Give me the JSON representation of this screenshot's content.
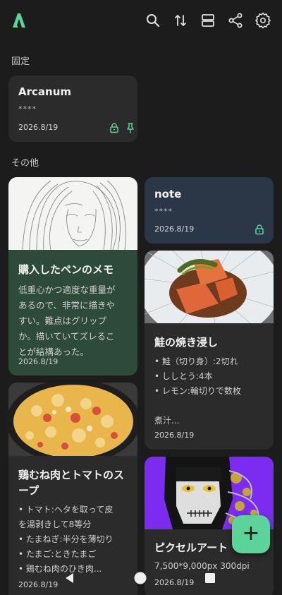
{
  "toolbar": {
    "logo_icon": "app-logo-icon",
    "icons": [
      "search-icon",
      "sort-icon",
      "layout-icon",
      "share-icon",
      "settings-icon"
    ],
    "accent_color": "#5bd39a"
  },
  "sections": {
    "pinned": "固定",
    "others": "その他"
  },
  "pinned_note": {
    "title": "Arcanum",
    "masked": "****",
    "date": "2026.8/19",
    "icons": [
      "lock-icon",
      "pin-icon"
    ]
  },
  "notes": {
    "pen_memo": {
      "title": "購入したペンのメモ",
      "body": [
        "低重心かつ適度な重量が",
        "あるので、非常に描きや",
        "すい。難点はグリップ",
        "か。描いていてズレるこ",
        "とが結構あった。"
      ],
      "date": "2026.8/19",
      "background": "#2e4a3a"
    },
    "locked_note": {
      "title": "note",
      "masked": "****",
      "date": "2026.8/19",
      "background": "#2b3746"
    },
    "salmon": {
      "title": "鮭の焼き浸し",
      "lines": [
        "• 鮭（切り身）:2切れ",
        "• ししとう:4本",
        "• レモン:輪切りで数枚",
        "",
        "煮汁..."
      ],
      "date": "2026.8/19"
    },
    "soup": {
      "title": [
        "鶏むね肉とトマトのス",
        "ープ"
      ],
      "lines": [
        "• トマト:ヘタを取って皮",
        "を湯剥きして8等分",
        "• たまねぎ:半分を薄切り",
        "• たまご:ときたまご",
        "• 鶏むね肉のひき肉..."
      ],
      "date": "2026.8/19"
    },
    "pixel_art": {
      "title": "ピクセルアート",
      "subtitle": "7,500*9,000px 300dpi",
      "date": "2026.8/19"
    }
  },
  "fab": {
    "label": "+"
  },
  "navigation": {
    "icons": [
      "back-icon",
      "home-icon",
      "recents-icon"
    ]
  }
}
